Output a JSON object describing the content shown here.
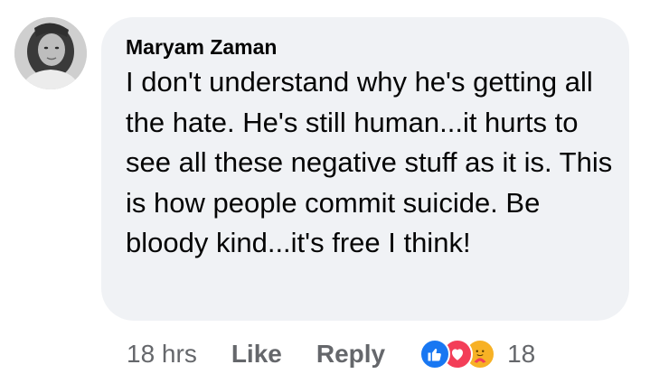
{
  "comment": {
    "author": "Maryam Zaman",
    "text": "I don't understand why he's getting all the hate. He's still human...it hurts to see all these negative stuff as it is. This is how people commit suicide. Be bloody kind...it's free I think!",
    "timestamp": "18 hrs",
    "like_label": "Like",
    "reply_label": "Reply",
    "reactions": {
      "icons": [
        "like-icon",
        "love-icon",
        "care-icon"
      ],
      "count": "18"
    }
  },
  "colors": {
    "bubble": "#f0f2f5",
    "text": "#050505",
    "secondary": "#65676b",
    "like": "#1877f2",
    "love": "#f33e58",
    "care": "#f7b125"
  }
}
